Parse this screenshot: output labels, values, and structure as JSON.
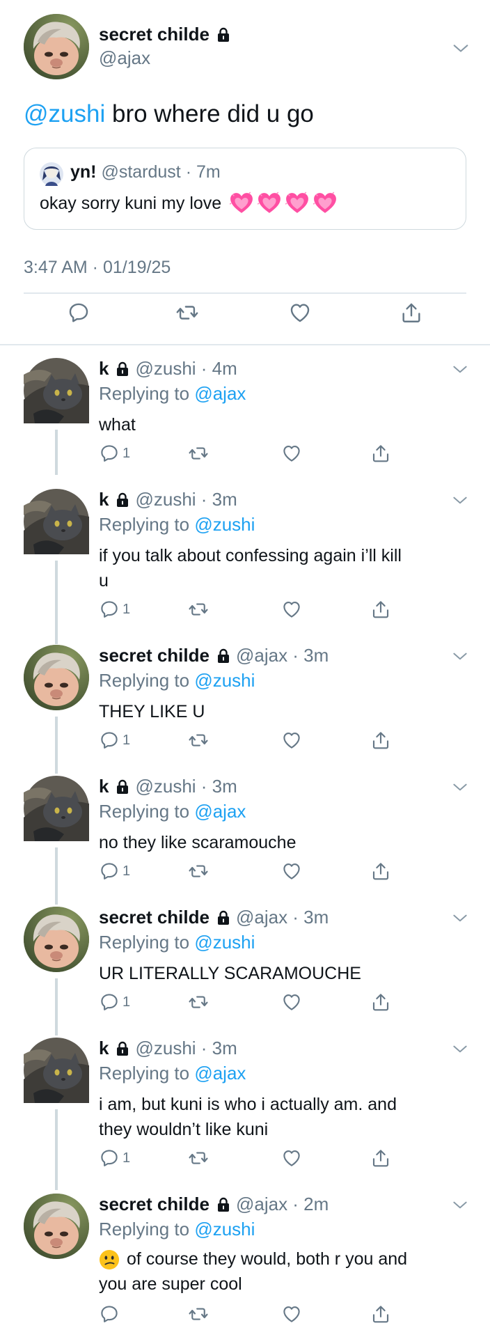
{
  "main_tweet": {
    "author_name": "secret childe",
    "author_handle": "@ajax",
    "text_mention": "@zushi",
    "text_rest": " bro where did u go",
    "quote": {
      "name": "yn!",
      "handle_time": " @stardust · 7m",
      "text": "okay sorry kuni my love",
      "emoji": "💗💗💗💗"
    },
    "timestamp": "3:47 AM · 01/19/25"
  },
  "replies": [
    {
      "name": "k",
      "handle_time": "@zushi · 4m",
      "replying_prefix": "Replying to",
      "replying_to": "@ajax",
      "text": "what",
      "reply_count": "1"
    },
    {
      "name": "k",
      "handle_time": "@zushi · 3m",
      "replying_prefix": "Replying to",
      "replying_to": "@zushi",
      "text_line1": "if you talk about confessing again i’ll kill",
      "text_line2": "u",
      "reply_count": "1"
    },
    {
      "name": "secret childe",
      "handle_time": "@ajax · 3m",
      "replying_prefix": "Replying to",
      "replying_to": "@zushi",
      "text": "THEY LIKE U",
      "reply_count": "1"
    },
    {
      "name": "k",
      "handle_time": "@zushi · 3m",
      "replying_prefix": "Replying to",
      "replying_to": "@ajax",
      "text": "no they like scaramouche",
      "reply_count": "1"
    },
    {
      "name": "secret childe",
      "handle_time": "@ajax · 3m",
      "replying_prefix": "Replying to",
      "replying_to": "@zushi",
      "text": "UR LITERALLY SCARAMOUCHE",
      "reply_count": "1"
    },
    {
      "name": "k",
      "handle_time": "@zushi · 3m",
      "replying_prefix": "Replying to",
      "replying_to": "@ajax",
      "text_line1": "i am, but kuni is who i actually am. and",
      "text_line2": "they wouldn’t like kuni",
      "reply_count": "1"
    },
    {
      "name": "secret childe",
      "handle_time": "@ajax · 2m",
      "replying_prefix": "Replying to",
      "replying_to": "@zushi",
      "text_line1": "of course they would, both r you and",
      "text_line2": "you are super cool",
      "emoji": "confused-face"
    }
  ],
  "colors": {
    "link": "#1da1f2",
    "secondary_text": "#657786",
    "thread_line": "#cfd9de",
    "heart_pink": "#ff4fa3"
  }
}
